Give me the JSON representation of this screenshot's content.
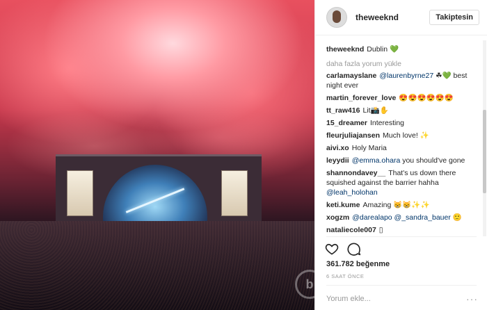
{
  "post": {
    "username": "theweeknd",
    "follow_label": "Takiptesin",
    "caption_user": "theweeknd",
    "caption_text": "Dublin 💚",
    "load_more": "daha fazla yorum yükle",
    "likes": "361.782 beğenme",
    "time": "6 SAAT ÖNCE",
    "add_comment_placeholder": "Yorum ekle...",
    "more_glyph": "···",
    "watermark": "b"
  },
  "comments": [
    {
      "user": "carlamayslane",
      "mention": "@laurenbyrne27",
      "text": "☘💚 best night ever"
    },
    {
      "user": "martin_forever_love",
      "mention": "",
      "text": "😍😍😍😍😍😍"
    },
    {
      "user": "tt_raw416",
      "mention": "",
      "text": "Lit📸✋"
    },
    {
      "user": "15_dreamer",
      "mention": "",
      "text": "Interesting"
    },
    {
      "user": "fleurjuliajansen",
      "mention": "",
      "text": "Much love! ✨"
    },
    {
      "user": "aivi.xo",
      "mention": "",
      "text": "Holy Maria"
    },
    {
      "user": "leyydii",
      "mention": "@emma.ohara",
      "text": "you should've gone"
    },
    {
      "user": "shannondavey__",
      "mention": "",
      "text": "That's us down there squished against the barrier hahha",
      "mention2": "@leah_holohan"
    },
    {
      "user": "keti.kume",
      "mention": "",
      "text": "Amazing 😸😸✨✨"
    },
    {
      "user": "xogzm",
      "mention": "@darealapo @_sandra_bauer",
      "text": "🙂"
    },
    {
      "user": "nataliecole007",
      "mention": "",
      "text": "▯"
    }
  ],
  "icons": {
    "like": "heart-icon",
    "comment": "comment-bubble-icon"
  }
}
